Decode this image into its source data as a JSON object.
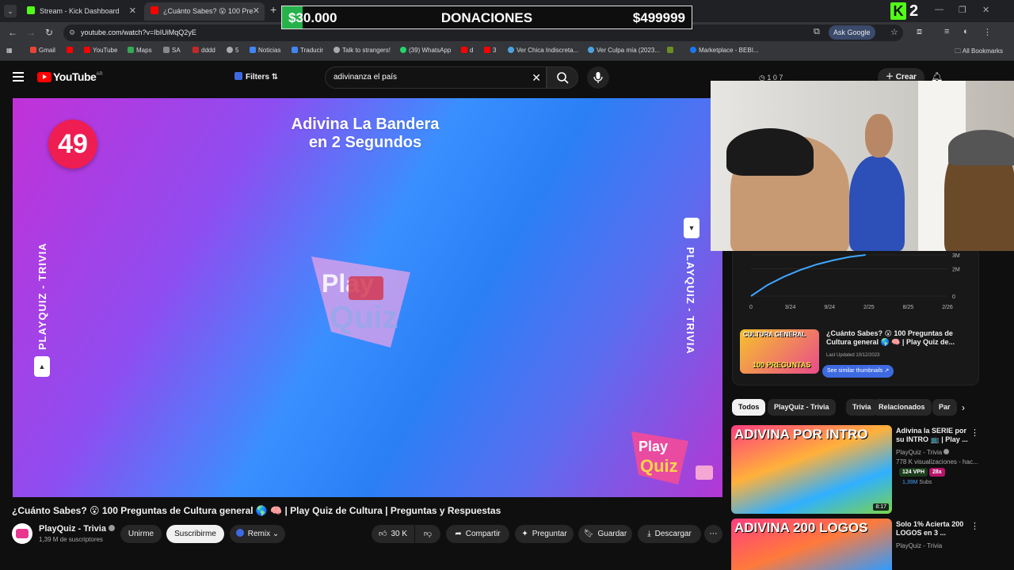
{
  "browser": {
    "tabs": [
      {
        "label": "Stream - Kick Dashboard",
        "color": "#53fc18"
      },
      {
        "label": "¿Cuánto Sabes? 😮 100 Pre",
        "color": "#ff0000"
      }
    ],
    "url": "youtube.com/watch?v=IbIUiMqQ2yE",
    "ask_google": "Ask Google",
    "bookmarks": [
      "Gmail",
      "YouTube",
      "Maps",
      "SA",
      "dddd",
      "5",
      "Noticias",
      "Traducir",
      "Talk to strangers!",
      "(39) WhatsApp",
      "d",
      "3",
      "Ver Chica Indiscreta...",
      "Ver Culpa mía (2023...",
      "Marketplace - BEBI..."
    ],
    "all_bookmarks": "All Bookmarks"
  },
  "donation": {
    "left_amount": "$30.000",
    "title": "DONACIONES",
    "right_amount": "$499999",
    "progress": 0.05,
    "bar_color": "#26b24b"
  },
  "kick": {
    "count": "2",
    "color": "#53fc18"
  },
  "youtube": {
    "logo": "YouTube",
    "region": "AR",
    "filters": "Filters",
    "search_query": "adivinanza el país",
    "header_stats": "1  0  7",
    "create": "Crear"
  },
  "player": {
    "counter": "49",
    "title_line1": "Adivina La Bandera",
    "title_line2": "en 2 Segundos",
    "side_label": "PLAYQUIZ - TRIVIA",
    "logo_top": "Play",
    "logo_bottom": "Quiz",
    "corner_logo_top": "Play",
    "corner_logo_bottom": "Quiz"
  },
  "video": {
    "title": "¿Cuánto Sabes? 😮 100 Preguntas de Cultura general 🌎 🧠 | Play Quiz de Cultura | Preguntas y Respuestas",
    "channel": "PlayQuiz - Trivia",
    "subscribers": "1,39 M de suscriptores",
    "join": "Unirme",
    "subscribe": "Suscribirme",
    "remix": "Remix",
    "likes": "30 K",
    "share": "Compartir",
    "ask": "Preguntar",
    "save": "Guardar",
    "download": "Descargar"
  },
  "stats_card": {
    "chart_data": {
      "type": "line",
      "x_ticks": [
        "0",
        "3/24",
        "9/24",
        "2/25",
        "8/25",
        "2/26"
      ],
      "y_ticks": [
        "0",
        "2M",
        "3M"
      ],
      "series": [
        {
          "values": [
            0,
            0.8,
            1.4,
            1.9,
            2.3,
            2.6,
            2.85,
            3.0
          ]
        }
      ]
    },
    "mini_title": "¿Cuánto Sabes? 😮 100 Preguntas de Cultura general 🌎 🧠 | Play Quiz de...",
    "last_updated": "Last Updated 10/12/2023",
    "similar": "See similar thumbnails ↗",
    "thumb_text_top": "CULTURA GENERAL",
    "thumb_text_bottom": "100 PREGUNTAS"
  },
  "chips": [
    "Todos",
    "PlayQuiz - Trivia",
    "Trivia",
    "Relacionados",
    "Par"
  ],
  "recommendations": [
    {
      "thumb_text": "ADIVINA POR INTRO",
      "title": "Adivina la SERIE por su INTRO 📺 | Play ...",
      "channel": "PlayQuiz - Trivia",
      "views": "778 K visualizaciones - hac...",
      "vph": "124 VPH",
      "multiplier": "28x",
      "subs": "1,39M",
      "subs_label": "Subs",
      "duration": "8:17"
    },
    {
      "thumb_text": "ADIVINA 200 LOGOS",
      "title": "Solo 1% Acierta 200 LOGOS en 3 ...",
      "channel": "PlayQuiz - Trivia"
    }
  ]
}
